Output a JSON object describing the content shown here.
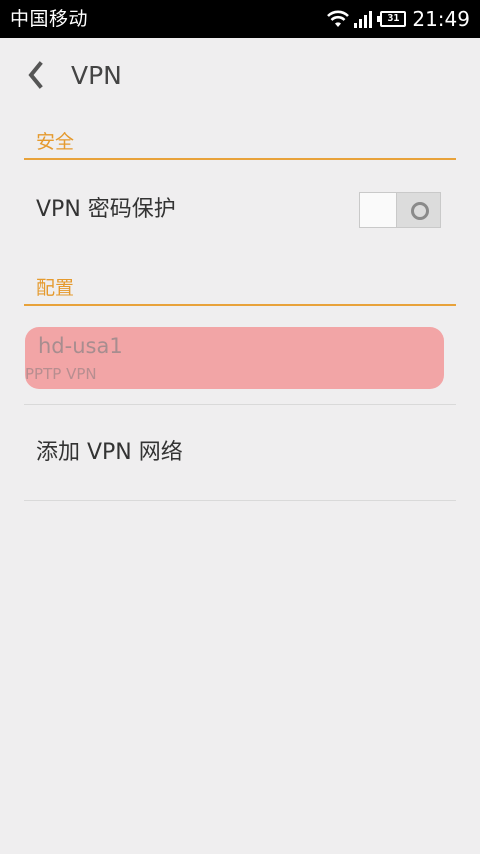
{
  "status_bar": {
    "carrier": "中国移动",
    "battery_level": "31",
    "time": "21:49"
  },
  "header": {
    "title": "VPN"
  },
  "sections": {
    "security": {
      "title": "安全",
      "vpn_password_protect": {
        "label": "VPN 密码保护",
        "enabled": false
      }
    },
    "config": {
      "title": "配置",
      "vpn_items": [
        {
          "name": "hd-usa1",
          "type": "PPTP VPN"
        }
      ],
      "add_label": "添加 VPN 网络"
    }
  },
  "colors": {
    "accent": "#e59a2e",
    "highlight": "#f2a5a6",
    "status_bar_bg": "#000000",
    "background": "#efeeef"
  },
  "icons": {
    "back": "chevron-left-icon",
    "wifi": "wifi-icon",
    "signal": "cellular-signal-icon",
    "battery": "battery-icon"
  }
}
